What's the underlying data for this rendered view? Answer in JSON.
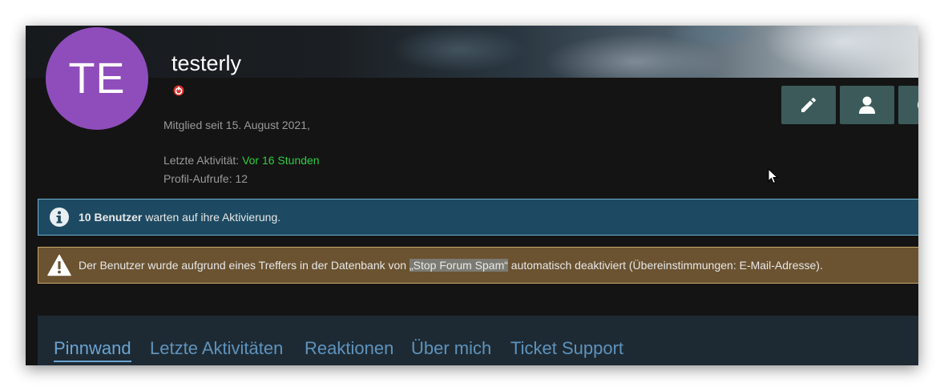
{
  "profile": {
    "avatar_initials": "TE",
    "avatar_color": "#8f4dbb",
    "username": "testerly",
    "status_icon": "offline-status-icon",
    "member_since": "Mitglied seit 15. August 2021,",
    "last_activity_label": "Letzte Aktivität:",
    "last_activity_value": "Vor 16 Stunden",
    "profile_views": "Profil-Aufrufe: 12"
  },
  "actions": [
    {
      "icon": "pencil-icon",
      "label": "edit"
    },
    {
      "icon": "user-icon",
      "label": "profile"
    },
    {
      "icon": "more-icon",
      "label": "more"
    }
  ],
  "notices": {
    "info": {
      "icon": "info-icon",
      "bold": "10 Benutzer",
      "text": " warten auf ihre Aktivierung.",
      "color": "#1d4a62"
    },
    "warning": {
      "icon": "warning-icon",
      "text_before": "Der Benutzer wurde aufgrund eines Treffers in der Datenbank von ",
      "highlight": "„Stop Forum Spam“",
      "text_after": " automatisch deaktiviert (Übereinstimmungen: E-Mail-Adresse).",
      "color": "#6b5331"
    }
  },
  "tabs": [
    {
      "label": "Pinnwand",
      "active": true
    },
    {
      "label": "Letzte Aktivitäten",
      "active": false
    },
    {
      "label": "Reaktionen",
      "active": false
    },
    {
      "label": "Über mich",
      "active": false
    },
    {
      "label": "Ticket Support",
      "active": false
    }
  ],
  "colors": {
    "accent_green": "#2ecc40",
    "tab_blue": "#6aa4d2",
    "button_teal": "#3c5a5a"
  }
}
